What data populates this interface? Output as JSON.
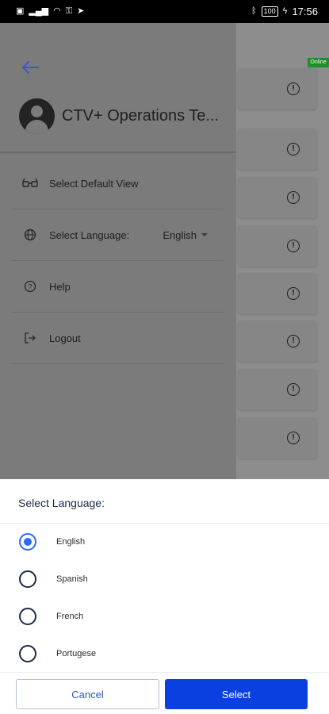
{
  "status_bar": {
    "time": "17:56",
    "battery": "100",
    "left_icons": [
      "sim-card-icon",
      "signal-icon",
      "wifi-icon",
      "key-icon",
      "location-arrow-icon"
    ],
    "right_icons": [
      "bluetooth-icon",
      "battery-icon",
      "charging-icon"
    ]
  },
  "background": {
    "online_badge": "Online",
    "card_icon": "!"
  },
  "drawer": {
    "profile_name": "CTV+ Operations Te...",
    "menu": [
      {
        "label": "Select Default View",
        "icon": "glasses-icon"
      },
      {
        "label": "Select Language:",
        "icon": "globe-icon",
        "value": "English"
      },
      {
        "label": "Help",
        "icon": "help-circle-icon"
      },
      {
        "label": "Logout",
        "icon": "logout-icon"
      }
    ]
  },
  "language_sheet": {
    "title": "Select Language:",
    "options": [
      "English",
      "Spanish",
      "French",
      "Portugese"
    ],
    "selected": "English",
    "cancel_label": "Cancel",
    "select_label": "Select"
  },
  "colors": {
    "accent": "#0a3fe0",
    "radio_selected": "#2b6df1",
    "online_badge": "#1f8f2a",
    "back_arrow": "#3c55c8"
  }
}
